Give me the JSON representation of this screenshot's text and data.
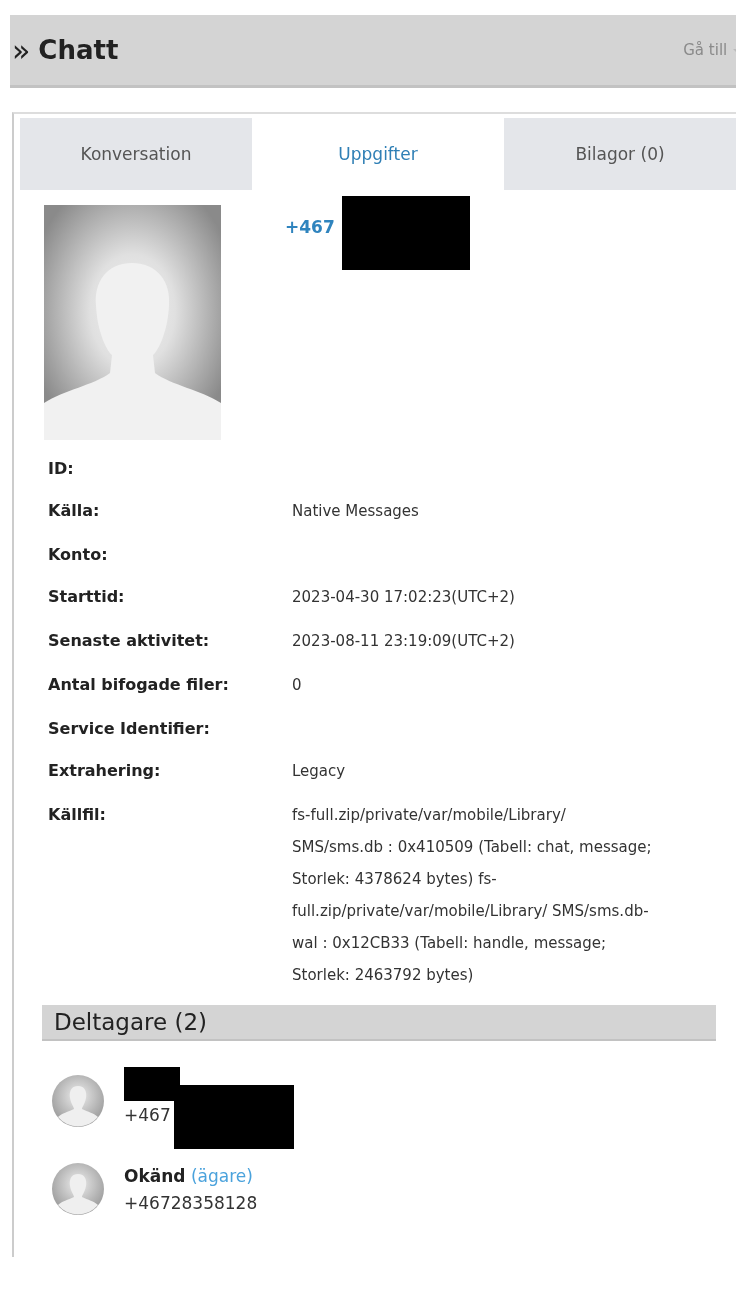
{
  "header": {
    "icon": "»",
    "title": "Chatt",
    "goto": "Gå till"
  },
  "tabs": [
    {
      "label": "Konversation",
      "selected": false
    },
    {
      "label": "Uppgifter",
      "selected": true
    },
    {
      "label": "Bilagor (0)",
      "selected": false
    }
  ],
  "contact": {
    "phone": "+467",
    "redacted": true
  },
  "details": [
    {
      "label": "ID:"
    },
    {
      "label": "Källa:",
      "value": "Native Messages"
    },
    {
      "label": "Konto:"
    },
    {
      "label": "Starttid:",
      "value": "2023-04-30 17:02:23(UTC+2)"
    },
    {
      "label": "Senaste aktivitet:",
      "value": "2023-08-11 23:19:09(UTC+2)"
    },
    {
      "label": "Antal bifogade filer:",
      "value": "0"
    },
    {
      "label": "Service Identifier:"
    },
    {
      "label": "Extrahering:",
      "value": "Legacy"
    },
    {
      "label": "Källfil:",
      "value": "fs-full.zip/private/var/mobile/Library/ SMS/sms.db : 0x410509 (Tabell: chat, message; Storlek: 4378624 bytes) fs-full.zip/private/var/mobile/Library/ SMS/sms.db-wal : 0x12CB33 (Tabell: handle, message; Storlek: 2463792 bytes)"
    }
  ],
  "participants_heading": "Deltagare (2)",
  "participants": [
    {
      "phone": "+467",
      "redacted": true
    },
    {
      "name": "Okänd",
      "role": "(ägare)",
      "phone": "+46728358128",
      "redacted": false
    }
  ]
}
